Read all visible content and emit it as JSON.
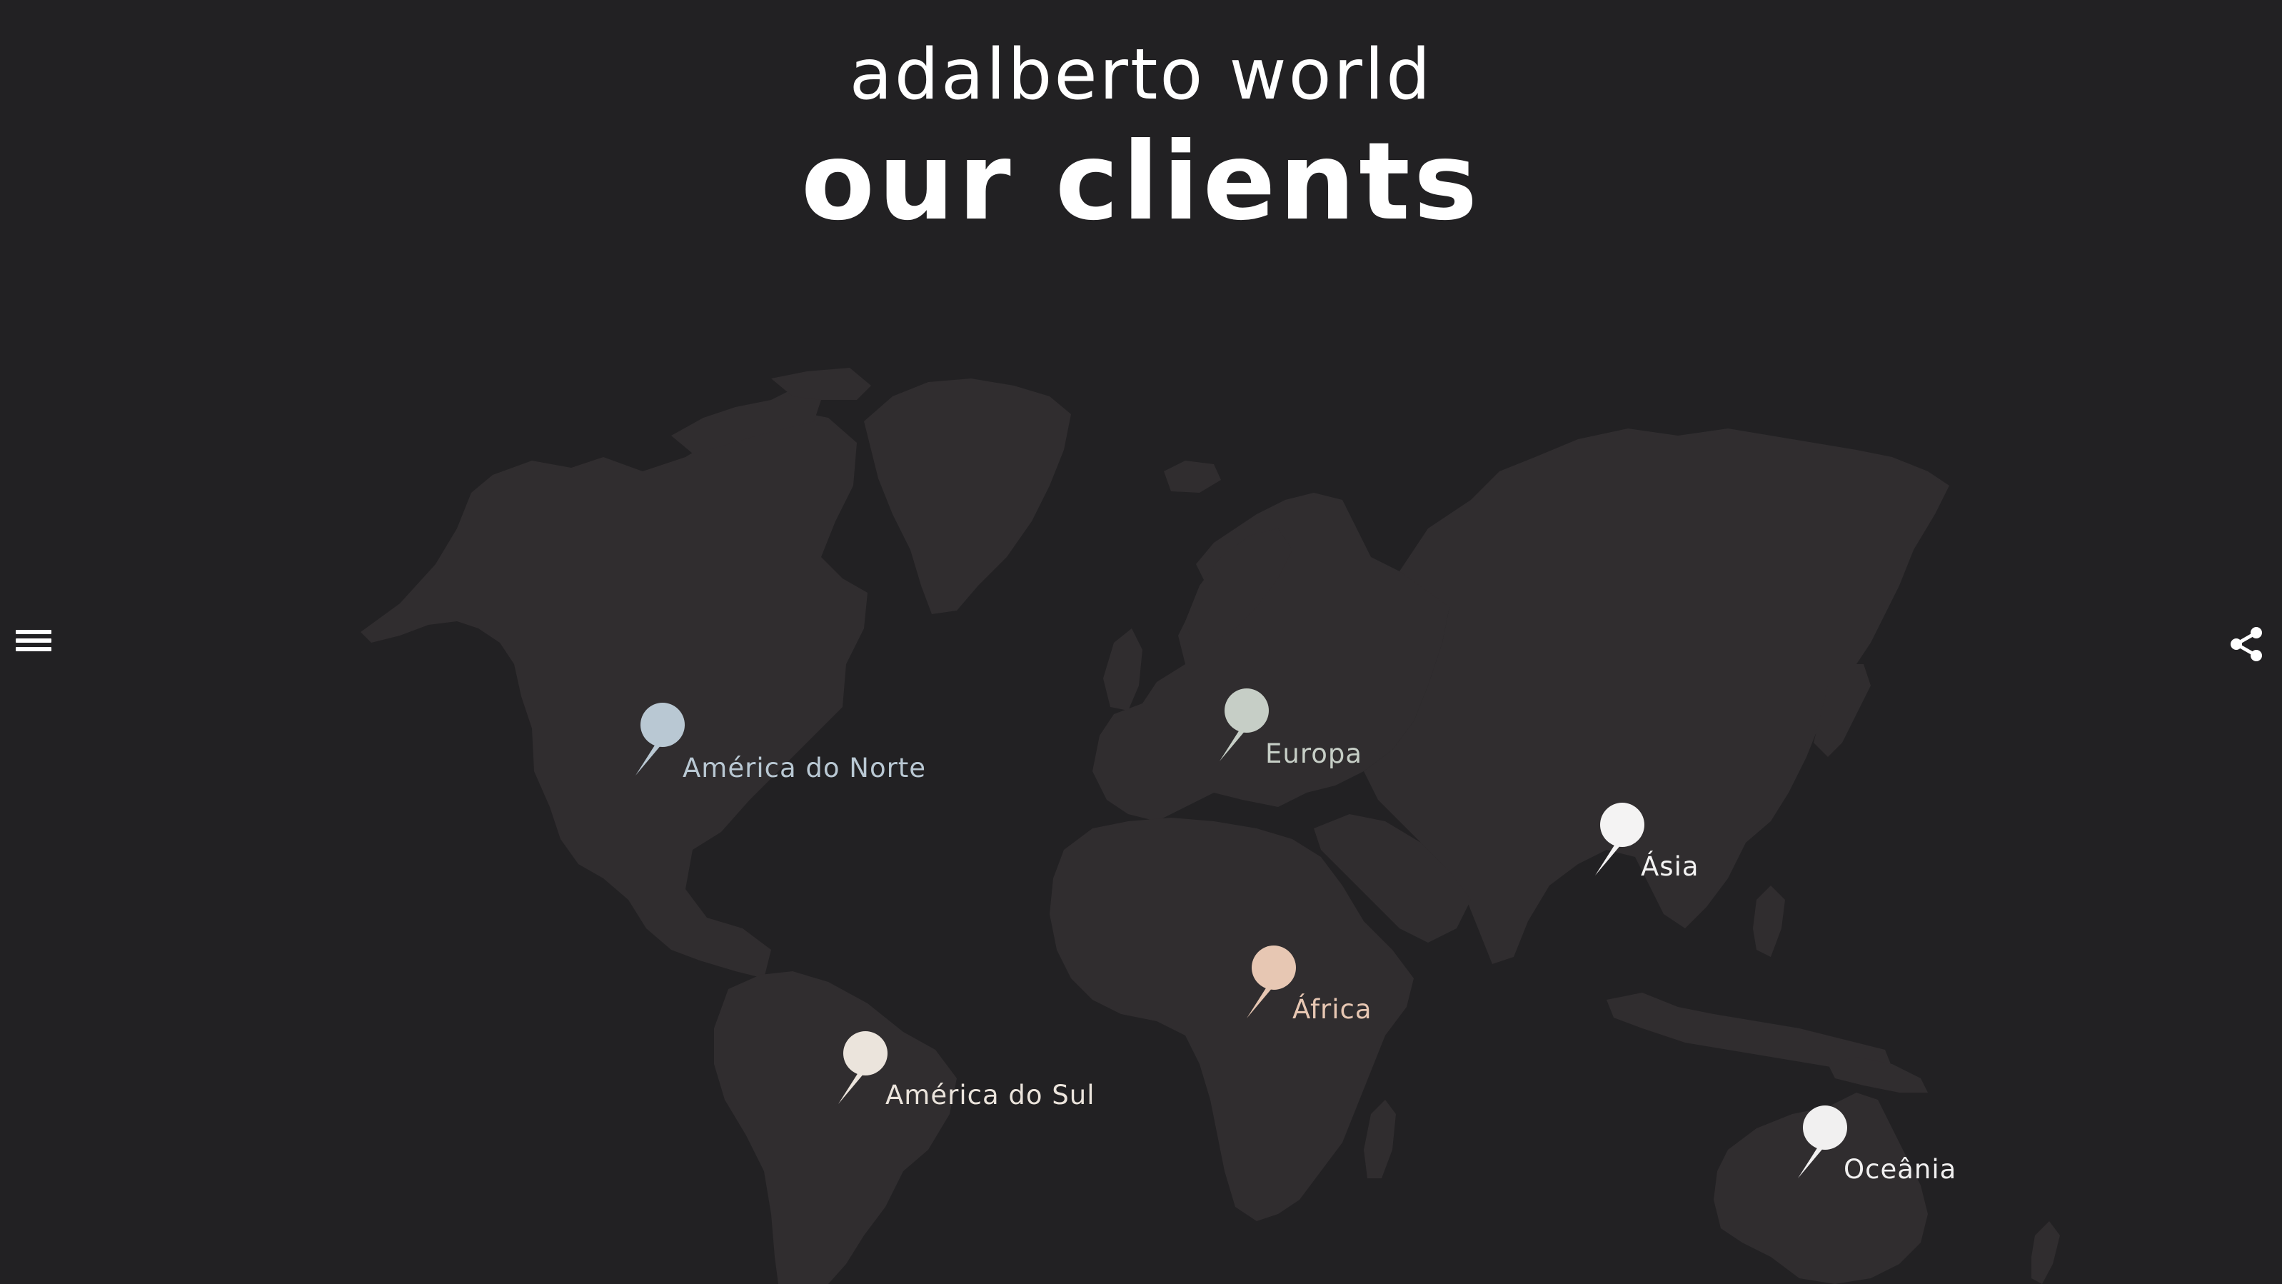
{
  "header": {
    "subtitle": "adalberto world",
    "title": "our clients"
  },
  "nav": {
    "menu_icon": "hamburger-menu-icon",
    "share_icon": "share-icon"
  },
  "map": {
    "land_color": "#302d2f",
    "background_color": "#222123",
    "markers": [
      {
        "label": "América do Norte",
        "color": "#b9c8d3"
      },
      {
        "label": "Europa",
        "color": "#c6cec6"
      },
      {
        "label": "Ásia",
        "color": "#f4f3f3"
      },
      {
        "label": "África",
        "color": "#e7c7b3"
      },
      {
        "label": "América do Sul",
        "color": "#ebe4dc"
      },
      {
        "label": "Oceânia",
        "color": "#f1f0f0"
      }
    ]
  }
}
